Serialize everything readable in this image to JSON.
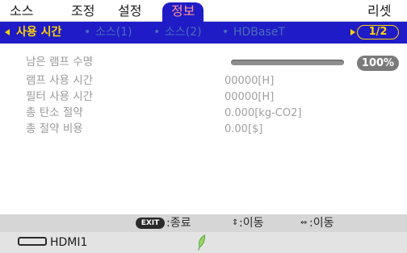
{
  "top_menu": {
    "items": [
      {
        "label": "소스"
      },
      {
        "label": "조정"
      },
      {
        "label": "설정"
      },
      {
        "label": "정보"
      }
    ],
    "reset_label": "리셋",
    "active_index": 3
  },
  "sub_tabs": {
    "items": [
      {
        "label": "사용 시간",
        "active": true
      },
      {
        "label": "소스(1)",
        "active": false
      },
      {
        "label": "소스(2)",
        "active": false
      },
      {
        "label": "HDBaseT",
        "active": false
      }
    ],
    "bullet": "•",
    "page_indicator": "1/2"
  },
  "info": {
    "lamp_life_label": "남은 램프 수명",
    "lamp_life_percent": 100,
    "lamp_life_display": "100%",
    "lamp_hours_label": "램프 사용 시간",
    "lamp_hours_value": "00000[H]",
    "filter_hours_label": "필터 사용 시간",
    "filter_hours_value": "00000[H]",
    "carbon_savings_label": "총 탄소 절약",
    "carbon_savings_value": "0.000[kg-CO2]",
    "cost_savings_label": "총 절약 비용",
    "cost_savings_value": "0.00[$]"
  },
  "hints": {
    "exit_key": "EXIT",
    "exit_label": ":종료",
    "updown_symbol": "⇕",
    "updown_label": ":이동",
    "leftright_symbol": "⇔",
    "leftright_label": ":이동"
  },
  "status": {
    "source_name": "HDMI1",
    "source_icon": "hdmi-connector-icon",
    "eco_icon": "leaf-icon"
  },
  "colors": {
    "accent_blue": "#1f1bc7",
    "active_tab_text": "#ffd300",
    "active_menu_text": "#ff9595",
    "eco_green": "#6cc24a"
  }
}
